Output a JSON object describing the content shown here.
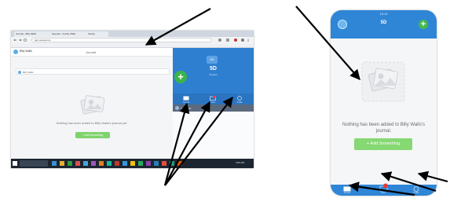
{
  "desktop": {
    "browser_tabs": [
      "Journal - Billy Walls",
      "Seesaw - Family Walls",
      "Family"
    ],
    "url": "app.seesaw.me",
    "header": {
      "user_name": "Billy Walls",
      "page_title": "Journal"
    },
    "filter_placeholder": "Billy Walls",
    "empty_message": "Nothing has been added to Billy Walls's journal yet.",
    "add_button": "+ Add Something",
    "class": {
      "badge": "5D",
      "name": "5D",
      "subtitle": "Student"
    },
    "tabs": [
      "Journal",
      "Inbox",
      "Profile"
    ],
    "post_text": "Billy Walls",
    "clock": "3:55 PM"
  },
  "phone": {
    "status_time": "10:10",
    "title": "5D",
    "empty_message": "Nothing has been added to Billy Walls's journal.",
    "add_button": "+ Add Something",
    "tabs": [
      "Journal",
      "Inbox",
      "Profile"
    ]
  },
  "colors": {
    "header_blue": "#2f86d6",
    "tab_blue": "#2a74c0",
    "add_green": "#7ed36b",
    "fab_green": "#3cb34a",
    "notification_red": "#e53935",
    "taskbar": "#1c2530"
  }
}
